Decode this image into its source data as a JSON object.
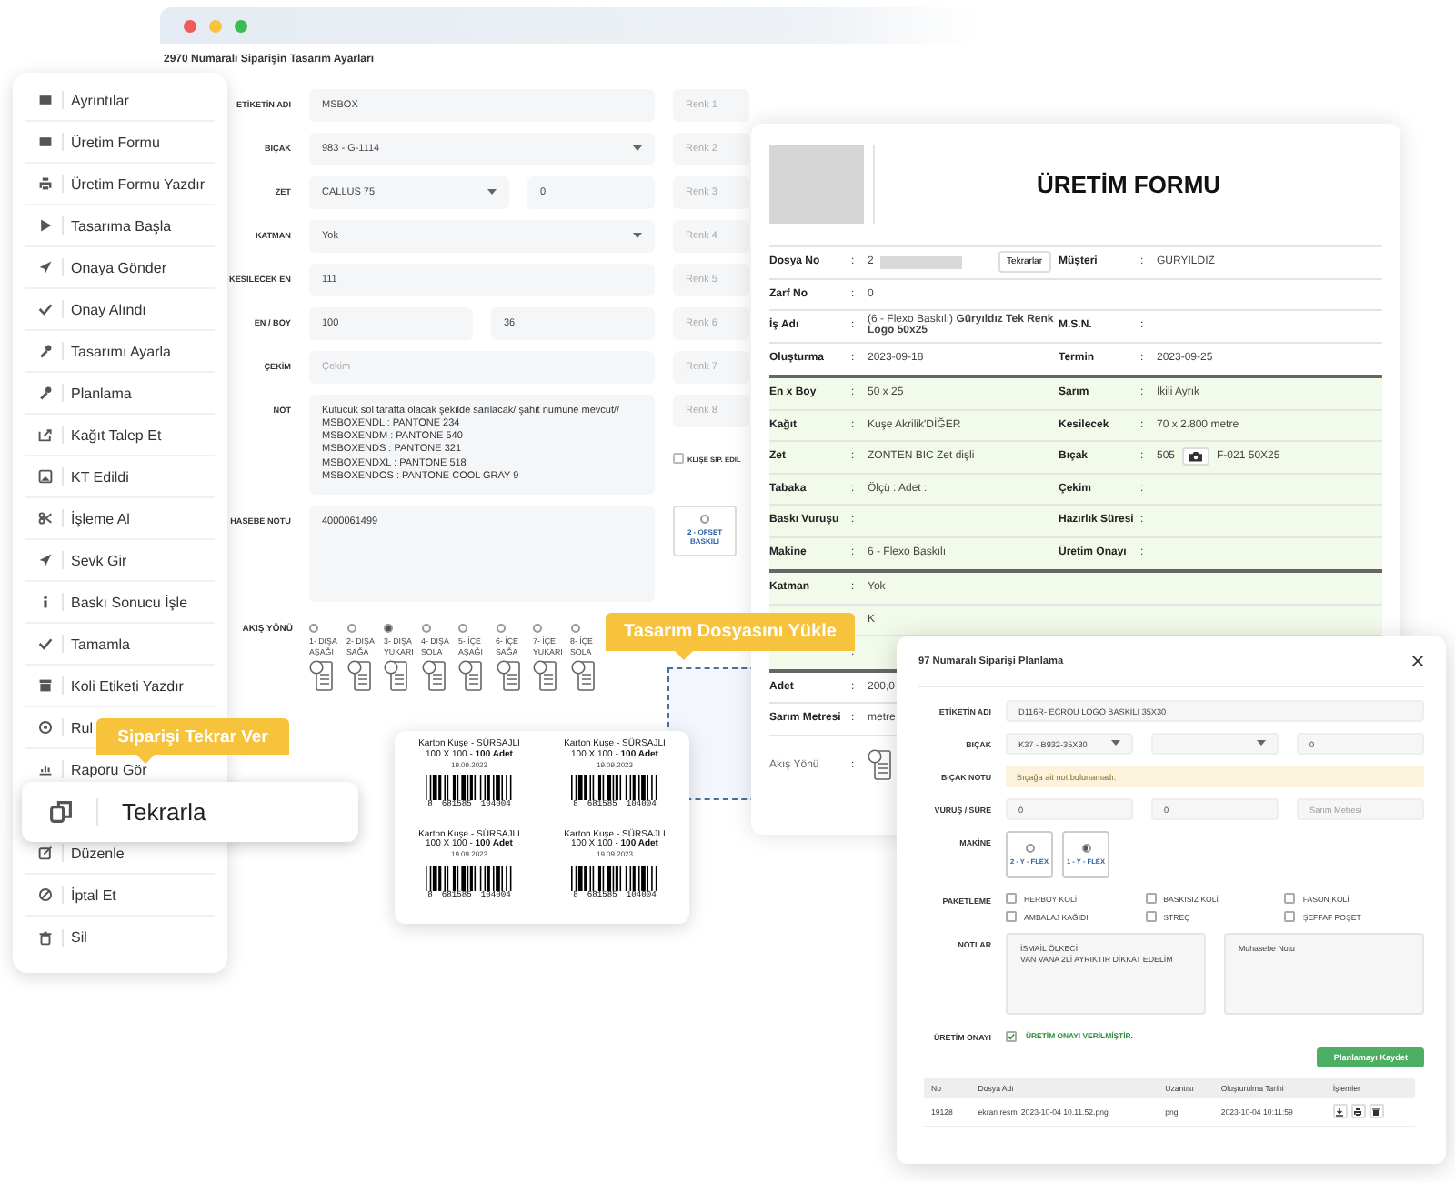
{
  "design_window": {
    "title": "2970 Numaralı Siparişin Tasarım Ayarları",
    "fields": [
      {
        "label": "ETİKETİN ADI",
        "kind": "text",
        "value": "MSBOX"
      },
      {
        "label": "BIÇAK",
        "kind": "select",
        "value": "983 - G-1114"
      },
      {
        "label": "ZET",
        "kind": "select_pair",
        "value": "CALLUS 75",
        "value2": "0"
      },
      {
        "label": "KATMAN",
        "kind": "select",
        "value": "Yok"
      },
      {
        "label": "KESİLECEK EN",
        "kind": "text",
        "value": "111"
      },
      {
        "label": "EN / BOY",
        "kind": "pair",
        "value": "100",
        "value2": "36"
      },
      {
        "label": "ÇEKİM",
        "kind": "text",
        "placeholder": "Çekim"
      },
      {
        "label": "NOT",
        "kind": "textarea",
        "value": "Kutucuk sol tarafta olacak şekilde sarılacak/ şahit numune mevcut//\nMSBOXENDL : PANTONE 234\nMSBOXENDM : PANTONE 540\nMSBOXENDS : PANTONE 321\nMSBOXENDXL : PANTONE 518\nMSBOXENDOS : PANTONE COOL GRAY 9"
      },
      {
        "label": "HASEBE NOTU",
        "kind": "textarea",
        "value": "4000061499"
      }
    ],
    "color_fields": [
      {
        "placeholder": "Renk 1"
      },
      {
        "placeholder": "Renk 2"
      },
      {
        "placeholder": "Renk 3"
      },
      {
        "placeholder": "Renk 4"
      },
      {
        "placeholder": "Renk 5"
      },
      {
        "placeholder": "Renk 6"
      },
      {
        "placeholder": "Renk 7"
      },
      {
        "placeholder": "Renk 8"
      }
    ],
    "cliche": {
      "label": "KLİŞE SİP. EDİL",
      "checked": false
    },
    "print_types": [
      {
        "label": "2 - OFSET BASKILI",
        "selected": false
      }
    ],
    "flow": {
      "label": "AKIŞ YÖNÜ",
      "options": [
        {
          "label": "1- DIŞA AŞAĞI",
          "selected": false
        },
        {
          "label": "2- DIŞA SAĞA",
          "selected": false
        },
        {
          "label": "3- DIŞA YUKARI",
          "selected": true
        },
        {
          "label": "4- DIŞA SOLA",
          "selected": false
        },
        {
          "label": "5- İÇE AŞAĞI",
          "selected": false
        },
        {
          "label": "6- İÇE SAĞA",
          "selected": false
        },
        {
          "label": "7- İÇE YUKARI",
          "selected": false
        },
        {
          "label": "8- İÇE SOLA",
          "selected": false
        }
      ]
    }
  },
  "menu": {
    "items": [
      {
        "label": "Ayrıntılar",
        "kind": "item"
      },
      {
        "label": "Üretim Formu",
        "kind": "item"
      },
      {
        "label": "Üretim Formu Yazdır",
        "kind": "item"
      },
      {
        "label": "Tasarıma Başla",
        "kind": "item"
      },
      {
        "label": "Onaya Gönder",
        "kind": "item"
      },
      {
        "label": "Onay Alındı",
        "kind": "item"
      },
      {
        "label": "Tasarımı Ayarla",
        "kind": "item"
      },
      {
        "label": "Planlama",
        "kind": "item"
      },
      {
        "label": "Kağıt Talep Et",
        "kind": "item"
      },
      {
        "label": "KT Edildi",
        "kind": "item"
      },
      {
        "label": "İşleme Al",
        "kind": "item"
      },
      {
        "label": "Sevk Gir",
        "kind": "item"
      },
      {
        "label": "Baskı Sonucu İşle",
        "kind": "item"
      },
      {
        "label": "Tamamla",
        "kind": "item"
      },
      {
        "label": "Koli Etiketi Yazdır",
        "kind": "item"
      },
      {
        "label": "Rul",
        "kind": "item"
      },
      {
        "label": "Raporu Gör",
        "kind": "item"
      },
      {
        "label": "Tekrarla",
        "kind": "popout",
        "tooltip": "Siparişi Tekrar Ver"
      },
      {
        "label": "Düzenle",
        "kind": "item"
      },
      {
        "label": "İptal Et",
        "kind": "item"
      },
      {
        "label": "Sil",
        "kind": "item"
      }
    ]
  },
  "upload": {
    "tooltip": "Tasarım Dosyasını Yükle"
  },
  "production_form": {
    "title": "ÜRETİM FORMU",
    "sections": [
      {
        "shaded": false,
        "rows": [
          {
            "cells": [
              {
                "label": "Dosya No",
                "colon": ":",
                "value": "2",
                "kind": "file",
                "button": "Tekrarlar"
              },
              {
                "label": "Müşteri",
                "colon": ":",
                "value": "GÜRYILDIZ"
              }
            ]
          },
          {
            "cells": [
              {
                "label": "Zarf No",
                "colon": ":",
                "value": "0"
              }
            ]
          },
          {
            "cells": [
              {
                "label": "İş Adı",
                "colon": ":",
                "value": "(6 - Flexo Baskılı) **Güryıldız Tek Renk Logo 50x25**"
              },
              {
                "label": "M.S.N.",
                "colon": ":"
              }
            ]
          },
          {
            "cells": [
              {
                "label": "Oluşturma",
                "colon": ":",
                "value": "2023-09-18"
              },
              {
                "label": "Termin",
                "colon": ":",
                "value": "2023-09-25"
              }
            ]
          }
        ]
      },
      {
        "shaded": true,
        "rows": [
          {
            "cells": [
              {
                "label": "En x Boy",
                "colon": ":",
                "value": "50 x 25"
              },
              {
                "label": "Sarım",
                "colon": ":",
                "value": "İkili Ayrık"
              }
            ]
          },
          {
            "cells": [
              {
                "label": "Kağıt",
                "colon": ":",
                "value": "Kuşe Akrilik'DİĞER"
              },
              {
                "label": "Kesilecek",
                "colon": ":",
                "value": "70 x 2.800 metre"
              }
            ]
          },
          {
            "cells": [
              {
                "label": "Zet",
                "colon": ":",
                "value": "ZONTEN BIC Zet dişli"
              },
              {
                "label": "Bıçak",
                "colon": ":",
                "value": "505",
                "kind": "camera",
                "value2": "F-021 50X25"
              }
            ]
          },
          {
            "cells": [
              {
                "label": "Tabaka",
                "colon": ":",
                "value": "Ölçü : Adet :"
              },
              {
                "label": "Çekim",
                "colon": ":"
              }
            ]
          },
          {
            "cells": [
              {
                "label": "Baskı Vuruşu",
                "colon": ":"
              },
              {
                "label": "Hazırlık Süresi",
                "colon": ":"
              }
            ]
          },
          {
            "cells": [
              {
                "label": "Makine",
                "colon": ":",
                "value": "6 - Flexo Baskılı"
              },
              {
                "label": "Üretim Onayı",
                "colon": ":"
              }
            ]
          }
        ]
      },
      {
        "shaded": true,
        "rows": [
          {
            "cells": [
              {
                "label": "Katman",
                "colon": ":",
                "value": "Yok"
              }
            ]
          },
          {
            "cells": [
              {
                "value": "K"
              }
            ]
          },
          {
            "cells": [
              {
                "colon": ":"
              }
            ]
          }
        ]
      },
      {
        "shaded": false,
        "rows": [
          {
            "cells": [
              {
                "label": "Adet",
                "colon": ":",
                "value": "200,0"
              }
            ]
          },
          {
            "cells": [
              {
                "label": "Sarım Metresi",
                "colon": ":",
                "value": "metre"
              }
            ]
          },
          {
            "cells": [
              {
                "label": "Akış Yönü",
                "colon": ":",
                "kind": "flow"
              }
            ]
          }
        ]
      }
    ]
  },
  "label_sheet": {
    "labels": [
      {
        "title": "Karton Kuşe - SÜRSAJLI",
        "size": "100 X 100 - **100 Adet**",
        "date": "19.09.2023",
        "code": [
          "8",
          "681585",
          "104004"
        ]
      },
      {
        "title": "Karton Kuşe - SÜRSAJLI",
        "size": "100 X 100 - **100 Adet**",
        "date": "19.09.2023",
        "code": [
          "8",
          "681585",
          "104004"
        ]
      },
      {
        "title": "Karton Kuşe - SÜRSAJLI",
        "size": "100 X 100 - **100 Adet**",
        "date": "19.09.2023",
        "code": [
          "8",
          "681585",
          "104004"
        ]
      },
      {
        "title": "Karton Kuşe - SÜRSAJLI",
        "size": "100 X 100 - **100 Adet**",
        "date": "19.09.2023",
        "code": [
          "8",
          "681585",
          "104004"
        ]
      }
    ]
  },
  "planning_dialog": {
    "title": "97 Numaralı Siparişi Planlama",
    "rows": [
      {
        "label": "ETİKETİN ADI",
        "kind": "fields",
        "fields": [
          {
            "kind": "text",
            "value": "D116R- ECROU LOGO BASKILI 35X30"
          }
        ]
      },
      {
        "label": "BIÇAK",
        "kind": "fields",
        "fields": [
          {
            "kind": "select",
            "value": "K37 - B932-35X30"
          },
          {
            "kind": "select"
          },
          {
            "kind": "text",
            "value": "0"
          }
        ]
      },
      {
        "label": "BIÇAK NOTU",
        "kind": "note",
        "text": "Bıçağa ait not bulunamadı."
      },
      {
        "label": "VURUŞ / SÜRE",
        "kind": "fields",
        "fields": [
          {
            "kind": "text",
            "value": "0"
          },
          {
            "kind": "text",
            "value": "0"
          },
          {
            "kind": "text",
            "placeholder": "Sarım Metresi"
          }
        ]
      },
      {
        "label": "MAKİNE",
        "kind": "machines",
        "options": [
          {
            "label": "2 - Y - FLEX",
            "selected": false
          },
          {
            "label": "1 - Y - FLEX",
            "selected": true
          }
        ]
      },
      {
        "label": "PAKETLEME",
        "kind": "checks",
        "options": [
          {
            "label": "HERBOY KOLİ",
            "checked": false
          },
          {
            "label": "BASKISIZ KOLİ",
            "checked": false
          },
          {
            "label": "FASON KOLİ",
            "checked": false
          },
          {
            "label": "AMBALAJ KAĞIDI",
            "checked": false
          },
          {
            "label": "STREÇ",
            "checked": false
          },
          {
            "label": "ŞEFFAF POŞET",
            "checked": false
          }
        ]
      },
      {
        "label": "NOTLAR",
        "kind": "notes",
        "fields": [
          {
            "kind": "textarea",
            "value": "İSMAİL ÖLKECİ\nVAN VANA 2Lİ AYRIKTIR DİKKAT EDELİM"
          },
          {
            "kind": "textarea",
            "placeholder": "Muhasebe Notu"
          }
        ]
      },
      {
        "label": "ÜRETİM ONAYI",
        "kind": "approval",
        "checked": true,
        "text": "ÜRETİM ONAYI VERİLMİŞTİR."
      }
    ],
    "save_button": "Planlamayı Kaydet",
    "files": {
      "columns": [
        "No",
        "Dosya Adı",
        "Uzantısı",
        "Oluşturulma Tarihi",
        "İşlemler"
      ],
      "rows": [
        {
          "cells": [
            "19128",
            "ekran resmi 2023-10-04 10.11.52.png",
            "png",
            "2023-10-04 10:11:59"
          ]
        }
      ]
    }
  }
}
